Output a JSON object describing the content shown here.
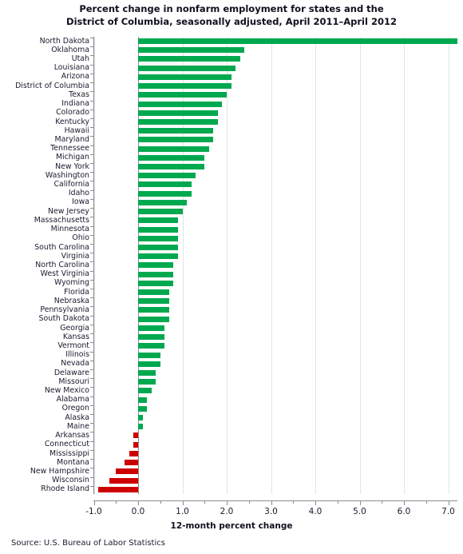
{
  "chart_data": {
    "type": "bar",
    "orientation": "horizontal",
    "title": "Percent change in nonfarm employment for states and the District of Columbia, seasonally adjusted, April 2011–April 2012",
    "title_lines": [
      "Percent change in nonfarm employment for states and the",
      "District of Columbia, seasonally adjusted, April 2011–April 2012"
    ],
    "xlabel": "12-month percent change",
    "ylabel": "",
    "xlim": [
      -1.0,
      7.5
    ],
    "xticks": [
      -1.0,
      0.0,
      1.0,
      2.0,
      3.0,
      4.0,
      5.0,
      6.0,
      7.0
    ],
    "xtick_labels": [
      "-1.0",
      "0.0",
      "1.0",
      "2.0",
      "3.0",
      "4.0",
      "5.0",
      "6.0",
      "7.0"
    ],
    "grid": true,
    "legend": false,
    "source": "Source: U.S. Bureau of Labor Statistics",
    "colors": {
      "positive": "#00a94f",
      "negative": "#cc0000",
      "gridline": "#e3e3e3",
      "axis": "#8c8c8c",
      "text": "#1a1a2e"
    },
    "categories": [
      "North Dakota",
      "Oklahoma",
      "Utah",
      "Louisiana",
      "Arizona",
      "District of Columbia",
      "Texas",
      "Indiana",
      "Colorado",
      "Kentucky",
      "Hawaii",
      "Maryland",
      "Tennessee",
      "Michigan",
      "New York",
      "Washington",
      "California",
      "Idaho",
      "Iowa",
      "New Jersey",
      "Massachusetts",
      "Minnesota",
      "Ohio",
      "South Carolina",
      "Virginia",
      "North Carolina",
      "West Virginia",
      "Wyoming",
      "Florida",
      "Nebraska",
      "Pennsylvania",
      "South Dakota",
      "Georgia",
      "Kansas",
      "Vermont",
      "Illinois",
      "Nevada",
      "Delaware",
      "Missouri",
      "New Mexico",
      "Alabama",
      "Oregon",
      "Alaska",
      "Maine",
      "Arkansas",
      "Connecticut",
      "Mississippi",
      "Montana",
      "New Hampshire",
      "Wisconsin",
      "Rhode Island"
    ],
    "values": [
      7.2,
      2.4,
      2.3,
      2.2,
      2.1,
      2.1,
      2.0,
      1.9,
      1.8,
      1.8,
      1.7,
      1.7,
      1.6,
      1.5,
      1.5,
      1.3,
      1.2,
      1.2,
      1.1,
      1.0,
      0.9,
      0.9,
      0.9,
      0.9,
      0.9,
      0.8,
      0.8,
      0.8,
      0.7,
      0.7,
      0.7,
      0.7,
      0.6,
      0.6,
      0.6,
      0.5,
      0.5,
      0.4,
      0.4,
      0.3,
      0.2,
      0.2,
      0.1,
      0.1,
      -0.1,
      -0.1,
      -0.2,
      -0.3,
      -0.5,
      -0.65,
      -0.9
    ]
  }
}
